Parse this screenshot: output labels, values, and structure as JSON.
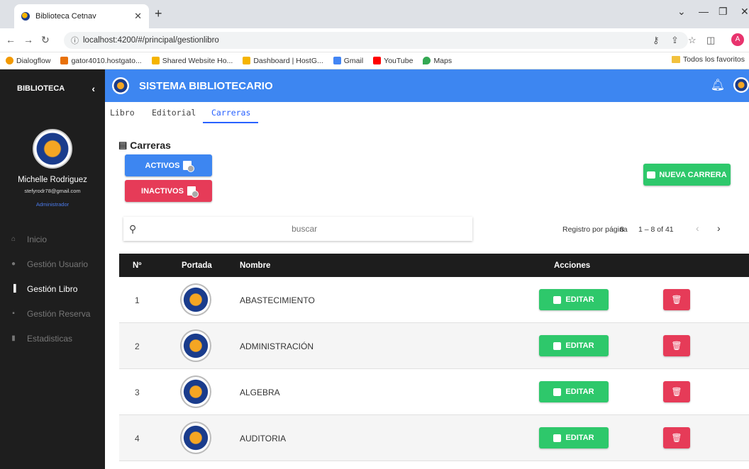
{
  "browser": {
    "tab_title": "Biblioteca Cetnav",
    "url": "localhost:4200/#/principal/gestionlibro",
    "bookmarks": [
      "Dialogflow",
      "gator4010.hostgato...",
      "Shared Website Ho...",
      "Dashboard | HostG...",
      "Gmail",
      "YouTube",
      "Maps"
    ],
    "favorites_folder": "Todos los favoritos",
    "profile_initial": "A"
  },
  "sidebar": {
    "header": "BIBLIOTECA",
    "user_name": "Michelle Rodriguez",
    "user_email": "stefyrodr78@gmail.com",
    "user_role": "Administrador",
    "items": [
      {
        "label": "Inicio",
        "icon": "home-icon"
      },
      {
        "label": "Gestión Usuario",
        "icon": "user-icon"
      },
      {
        "label": "Gestión Libro",
        "icon": "book-icon"
      },
      {
        "label": "Gestión Reserva",
        "icon": "calendar-icon"
      },
      {
        "label": "Estadisticas",
        "icon": "bar-chart-icon"
      }
    ],
    "active_item": "Gestión Libro"
  },
  "topbar": {
    "title": "SISTEMA BIBLIOTECARIO"
  },
  "tabs": [
    "Libro",
    "Editorial",
    "Carreras"
  ],
  "active_tab": "Carreras",
  "section": {
    "title": "Carreras",
    "activos_label": "ACTIVOS",
    "inactivos_label": "INACTIVOS",
    "nueva_label": "NUEVA CARRERA"
  },
  "search": {
    "placeholder": "buscar"
  },
  "paginator": {
    "page_size_label": "Registro por página",
    "page_size": "8",
    "range": "1 – 8 of 41"
  },
  "table": {
    "headers": [
      "Nº",
      "Portada",
      "Nombre",
      "Acciones"
    ],
    "edit_label": "EDITAR",
    "rows": [
      {
        "num": "1",
        "name": "ABASTECIMIENTO"
      },
      {
        "num": "2",
        "name": "ADMINISTRACIÓN"
      },
      {
        "num": "3",
        "name": "ALGEBRA"
      },
      {
        "num": "4",
        "name": "AUDITORIA"
      }
    ]
  },
  "colors": {
    "primary": "#3d86f1",
    "success": "#2ec86b",
    "danger": "#e63b58",
    "sidebar": "#1e1e1e"
  }
}
